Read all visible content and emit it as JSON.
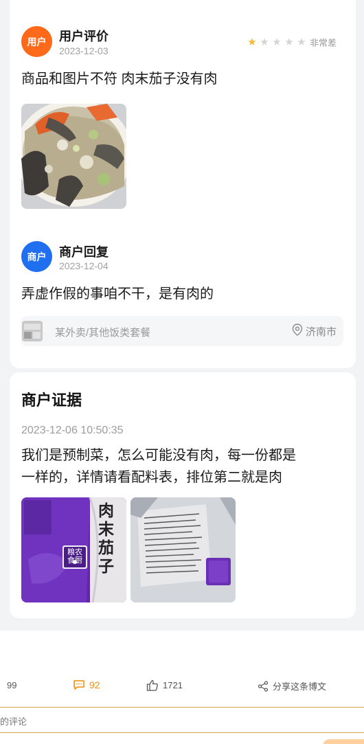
{
  "review": {
    "avatar_text": "用户",
    "name": "用户评价",
    "date": "2023-12-03",
    "rating": 1,
    "rating_max": 5,
    "rating_label": "非常差",
    "text": "商品和图片不符 肉末茄子没有肉"
  },
  "reply": {
    "avatar_text": "商户",
    "name": "商户回复",
    "date": "2023-12-04",
    "text": "弄虚作假的事咱不干，是有肉的"
  },
  "shop": {
    "name": "某外卖/其他饭类套餐",
    "location": "济南市"
  },
  "evidence": {
    "title": "商户证据",
    "time": "2023-12-06 10:50:35",
    "line1": "我们是预制菜，怎么可能没有肉，每一份都是",
    "line2": "一样的，详情请看配料表，排位第二就是肉",
    "package_label": "肉末茄子",
    "brand_label": "粮农\n食厨"
  },
  "actions": {
    "repost_count": "99",
    "comment_count": "92",
    "like_count": "1721",
    "share_label": "分享这条博文"
  },
  "comment_box": {
    "placeholder": "的评论"
  },
  "colors": {
    "user_avatar": "#ff6a1a",
    "merchant_avatar": "#1f6ff0",
    "star_on": "#f5b82e",
    "comment_accent": "#f28b00",
    "package_purple": "#6a2fb5"
  }
}
